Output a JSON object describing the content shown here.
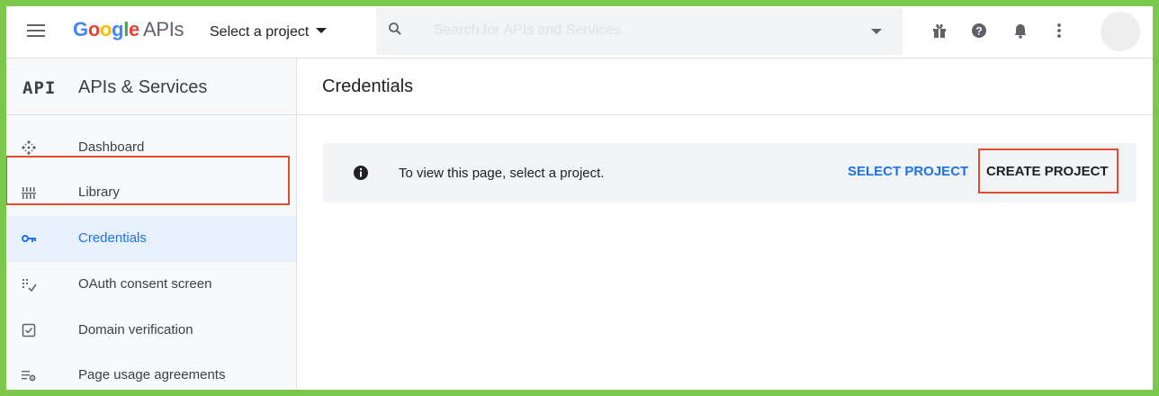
{
  "topbar": {
    "brand_g": "G",
    "brand_o1": "o",
    "brand_o2": "o",
    "brand_g2": "g",
    "brand_l": "l",
    "brand_e": "e",
    "brand_suffix": "APIs",
    "project_picker_label": "Select a project",
    "search_placeholder": "Search for APIs and Services",
    "icons": [
      "menu-icon",
      "search-icon",
      "gift-icon",
      "help-icon",
      "notifications-icon",
      "more-vert-icon"
    ]
  },
  "sidebar": {
    "logo": "API",
    "title": "APIs & Services",
    "items": [
      {
        "label": "Dashboard",
        "icon": "dashboard-icon"
      },
      {
        "label": "Library",
        "icon": "library-icon"
      },
      {
        "label": "Credentials",
        "icon": "key-icon",
        "active": true
      },
      {
        "label": "OAuth consent screen",
        "icon": "oauth-icon"
      },
      {
        "label": "Domain verification",
        "icon": "checkbox-icon"
      },
      {
        "label": "Page usage agreements",
        "icon": "settings-list-icon"
      }
    ]
  },
  "main": {
    "title": "Credentials",
    "notice": {
      "text": "To view this page, select a project.",
      "select_project": "SELECT PROJECT",
      "create_project": "CREATE PROJECT"
    }
  },
  "colors": {
    "frame": "#7cc84a",
    "highlight": "#e34b2f",
    "accent": "#1a73e8",
    "google_blue": "#4285f4",
    "google_red": "#ea4335",
    "google_yellow": "#fbbc05",
    "google_green": "#34a853"
  }
}
